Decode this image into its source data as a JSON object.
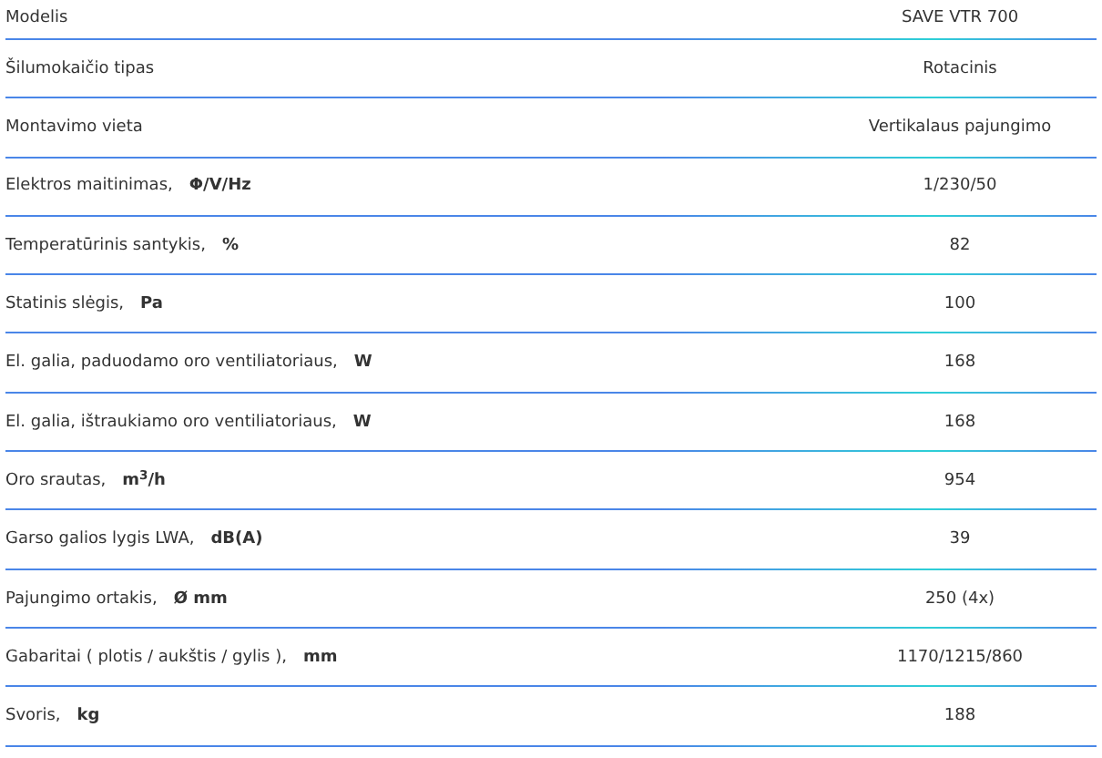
{
  "rows": [
    {
      "label": "Modelis",
      "value": "SAVE VTR 700"
    },
    {
      "label": "Šilumokaičio tipas",
      "value": "Rotacinis"
    },
    {
      "label": "Montavimo vieta",
      "value": "Vertikalaus pajungimo"
    },
    {
      "label": "Elektros maitinimas,",
      "unit": "Φ/V/Hz",
      "value": "1/230/50"
    },
    {
      "label": "Temperatūrinis santykis,",
      "unit": "%",
      "value": "82"
    },
    {
      "label": "Statinis slėgis,",
      "unit": "Pa",
      "value": "100"
    },
    {
      "label": "El. galia, paduodamo oro ventiliatoriaus,",
      "unit": "W",
      "value": "168"
    },
    {
      "label": "El. galia, ištraukiamo oro ventiliatoriaus,",
      "unit": "W",
      "value": "168"
    },
    {
      "label": "Oro srautas,",
      "unit": "m$^{3}$/h",
      "value": "954"
    },
    {
      "label": "Garso galios lygis LWA,",
      "unit": "dB(A)",
      "value": "39"
    },
    {
      "label": "Pajungimo ortakis,",
      "unit": "Ø mm",
      "value": "250 (4x)"
    },
    {
      "label": "Gabaritai ( plotis / aukštis / gylis ),",
      "unit": "mm",
      "value": "1170/1215/860"
    },
    {
      "label": "Svoris,",
      "unit": "kg",
      "value": "188"
    }
  ]
}
